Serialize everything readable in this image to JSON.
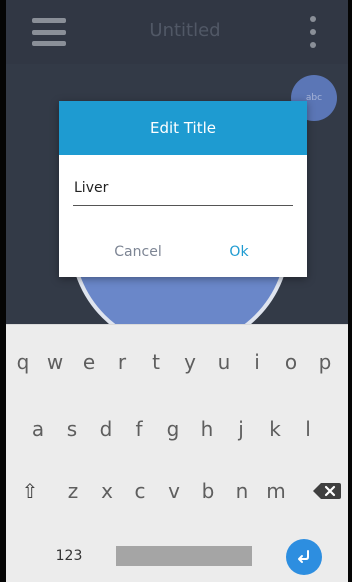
{
  "app": {
    "title": "Untitled",
    "fab_label": "abc"
  },
  "dialog": {
    "title": "Edit Title",
    "input_value": "Liver",
    "cancel_label": "Cancel",
    "ok_label": "Ok"
  },
  "keyboard": {
    "row1": [
      "q",
      "w",
      "e",
      "r",
      "t",
      "y",
      "u",
      "i",
      "o",
      "p"
    ],
    "row2": [
      "a",
      "s",
      "d",
      "f",
      "g",
      "h",
      "j",
      "k",
      "l"
    ],
    "row3": [
      "z",
      "x",
      "c",
      "v",
      "b",
      "n",
      "m"
    ],
    "shift_icon": "⇧",
    "num_label": "123"
  },
  "colors": {
    "background": "#333a47",
    "dialog_header": "#1e9bd1",
    "enter_key": "#2d8ee0",
    "circle": "#6a87c9"
  },
  "icons": {
    "menu": "menu-icon",
    "more": "more-vertical-icon",
    "shift": "shift-icon",
    "backspace": "backspace-icon",
    "enter": "enter-icon"
  }
}
